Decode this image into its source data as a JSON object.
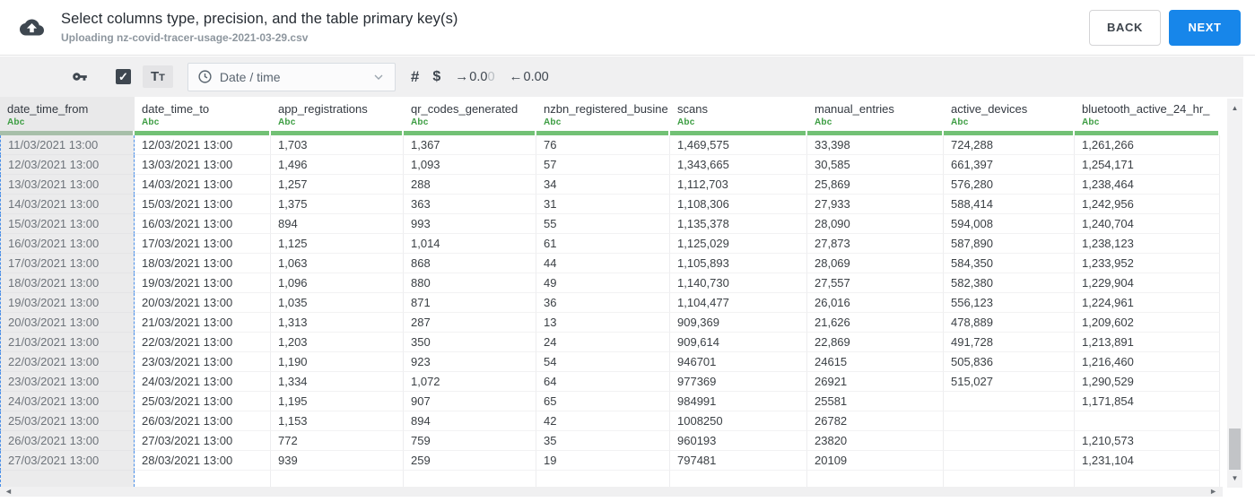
{
  "header": {
    "title": "Select columns type, precision, and the table primary key(s)",
    "subtitle": "Uploading nz-covid-tracer-usage-2021-03-29.csv",
    "back_label": "BACK",
    "next_label": "NEXT"
  },
  "toolbar": {
    "key_icon": "primary-key",
    "checkbox_checked": true,
    "checkbox_glyph": "✓",
    "text_type_label": "Tt",
    "type_dropdown_value": "Date / time",
    "number_type_label": "#",
    "currency_type_label": "$",
    "decimal_increase": {
      "arrow": "→",
      "main": "0.0",
      "faded": "0"
    },
    "decimal_decrease": {
      "arrow": "←",
      "main": "0.00",
      "faded": ""
    }
  },
  "colors": {
    "accent_blue": "#1786ea",
    "type_green": "#3c9d42",
    "bar_green": "#72c175",
    "selection_dash_blue": "#4a8fe8"
  },
  "table": {
    "type_label": "Abc",
    "selected_column": "date_time_from",
    "columns": [
      "date_time_from",
      "date_time_to",
      "app_registrations",
      "qr_codes_generated",
      "nzbn_registered_busine",
      "scans",
      "manual_entries",
      "active_devices",
      "bluetooth_active_24_hr_"
    ],
    "rows": [
      [
        "11/03/2021 13:00",
        "12/03/2021 13:00",
        "1,703",
        "1,367",
        "76",
        "1,469,575",
        "33,398",
        "724,288",
        "1,261,266"
      ],
      [
        "12/03/2021 13:00",
        "13/03/2021 13:00",
        "1,496",
        "1,093",
        "57",
        "1,343,665",
        "30,585",
        "661,397",
        "1,254,171"
      ],
      [
        "13/03/2021 13:00",
        "14/03/2021 13:00",
        "1,257",
        "288",
        "34",
        "1,112,703",
        "25,869",
        "576,280",
        "1,238,464"
      ],
      [
        "14/03/2021 13:00",
        "15/03/2021 13:00",
        "1,375",
        "363",
        "31",
        "1,108,306",
        "27,933",
        "588,414",
        "1,242,956"
      ],
      [
        "15/03/2021 13:00",
        "16/03/2021 13:00",
        "894",
        "993",
        "55",
        "1,135,378",
        "28,090",
        "594,008",
        "1,240,704"
      ],
      [
        "16/03/2021 13:00",
        "17/03/2021 13:00",
        "1,125",
        "1,014",
        "61",
        "1,125,029",
        "27,873",
        "587,890",
        "1,238,123"
      ],
      [
        "17/03/2021 13:00",
        "18/03/2021 13:00",
        "1,063",
        "868",
        "44",
        "1,105,893",
        "28,069",
        "584,350",
        "1,233,952"
      ],
      [
        "18/03/2021 13:00",
        "19/03/2021 13:00",
        "1,096",
        "880",
        "49",
        "1,140,730",
        "27,557",
        "582,380",
        "1,229,904"
      ],
      [
        "19/03/2021 13:00",
        "20/03/2021 13:00",
        "1,035",
        "871",
        "36",
        "1,104,477",
        "26,016",
        "556,123",
        "1,224,961"
      ],
      [
        "20/03/2021 13:00",
        "21/03/2021 13:00",
        "1,313",
        "287",
        "13",
        "909,369",
        "21,626",
        "478,889",
        "1,209,602"
      ],
      [
        "21/03/2021 13:00",
        "22/03/2021 13:00",
        "1,203",
        "350",
        "24",
        "909,614",
        "22,869",
        "491,728",
        "1,213,891"
      ],
      [
        "22/03/2021 13:00",
        "23/03/2021 13:00",
        "1,190",
        "923",
        "54",
        "946701",
        "24615",
        "505,836",
        "1,216,460"
      ],
      [
        "23/03/2021 13:00",
        "24/03/2021 13:00",
        "1,334",
        "1,072",
        "64",
        "977369",
        "26921",
        "515,027",
        "1,290,529"
      ],
      [
        "24/03/2021 13:00",
        "25/03/2021 13:00",
        "1,195",
        "907",
        "65",
        "984991",
        "25581",
        "",
        "1,171,854"
      ],
      [
        "25/03/2021 13:00",
        "26/03/2021 13:00",
        "1,153",
        "894",
        "42",
        "1008250",
        "26782",
        "",
        ""
      ],
      [
        "26/03/2021 13:00",
        "27/03/2021 13:00",
        "772",
        "759",
        "35",
        "960193",
        "23820",
        "",
        "1,210,573"
      ],
      [
        "27/03/2021 13:00",
        "28/03/2021 13:00",
        "939",
        "259",
        "19",
        "797481",
        "20109",
        "",
        "1,231,104"
      ]
    ]
  }
}
